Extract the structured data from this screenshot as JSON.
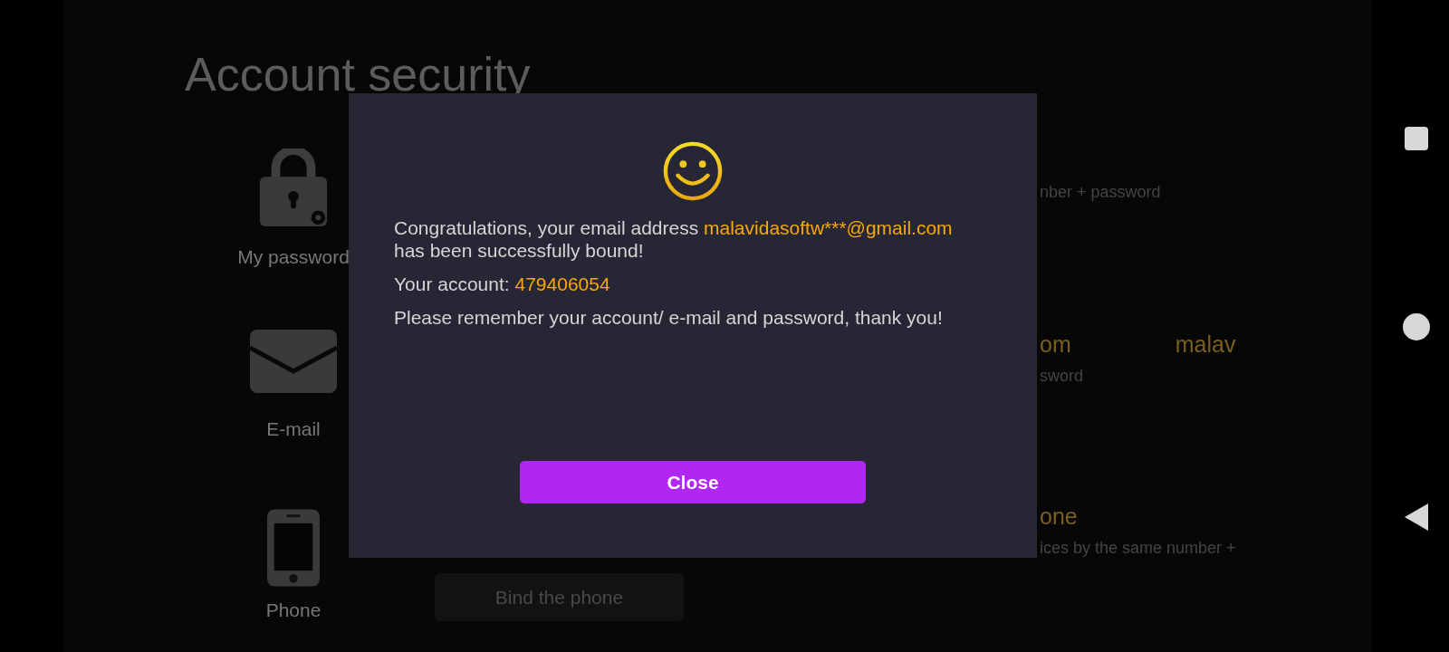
{
  "page": {
    "title": "Account security"
  },
  "sections": [
    {
      "kind": "password",
      "label": "My password",
      "note": "nber + password"
    },
    {
      "kind": "email",
      "label": "E-mail",
      "heading": [
        "om",
        "malav"
      ],
      "note": "sword"
    },
    {
      "kind": "phone",
      "label": "Phone",
      "heading": [
        "one"
      ],
      "note": "ices by the same number +",
      "button": "Bind the phone"
    }
  ],
  "dialog": {
    "message": "Congratulations, your email address ",
    "email": "malavidasoftw***@gmail.com",
    "message_end": "has been successfully bound!",
    "account_label": "Your account: ",
    "account": "479406054",
    "reminder": "Please remember your account/ e-mail and password, thank you!",
    "close_button": "Close"
  }
}
